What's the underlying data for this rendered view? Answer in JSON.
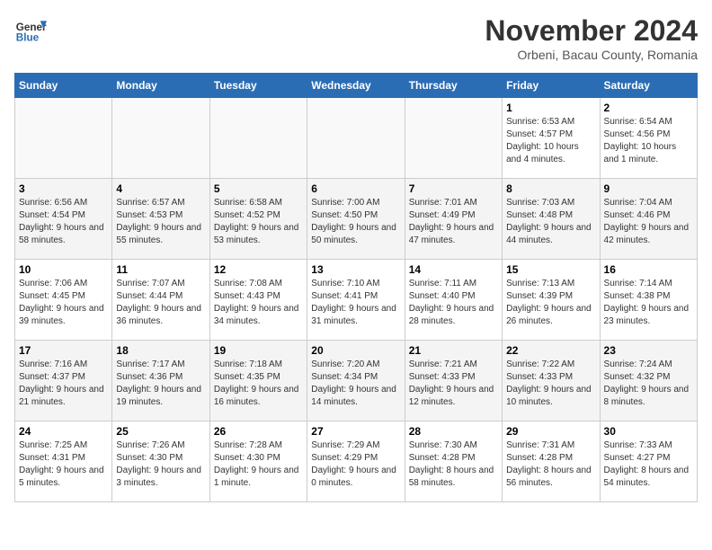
{
  "header": {
    "logo_line1": "General",
    "logo_line2": "Blue",
    "title": "November 2024",
    "subtitle": "Orbeni, Bacau County, Romania"
  },
  "weekdays": [
    "Sunday",
    "Monday",
    "Tuesday",
    "Wednesday",
    "Thursday",
    "Friday",
    "Saturday"
  ],
  "weeks": [
    [
      {
        "day": "",
        "info": ""
      },
      {
        "day": "",
        "info": ""
      },
      {
        "day": "",
        "info": ""
      },
      {
        "day": "",
        "info": ""
      },
      {
        "day": "",
        "info": ""
      },
      {
        "day": "1",
        "info": "Sunrise: 6:53 AM\nSunset: 4:57 PM\nDaylight: 10 hours and 4 minutes."
      },
      {
        "day": "2",
        "info": "Sunrise: 6:54 AM\nSunset: 4:56 PM\nDaylight: 10 hours and 1 minute."
      }
    ],
    [
      {
        "day": "3",
        "info": "Sunrise: 6:56 AM\nSunset: 4:54 PM\nDaylight: 9 hours and 58 minutes."
      },
      {
        "day": "4",
        "info": "Sunrise: 6:57 AM\nSunset: 4:53 PM\nDaylight: 9 hours and 55 minutes."
      },
      {
        "day": "5",
        "info": "Sunrise: 6:58 AM\nSunset: 4:52 PM\nDaylight: 9 hours and 53 minutes."
      },
      {
        "day": "6",
        "info": "Sunrise: 7:00 AM\nSunset: 4:50 PM\nDaylight: 9 hours and 50 minutes."
      },
      {
        "day": "7",
        "info": "Sunrise: 7:01 AM\nSunset: 4:49 PM\nDaylight: 9 hours and 47 minutes."
      },
      {
        "day": "8",
        "info": "Sunrise: 7:03 AM\nSunset: 4:48 PM\nDaylight: 9 hours and 44 minutes."
      },
      {
        "day": "9",
        "info": "Sunrise: 7:04 AM\nSunset: 4:46 PM\nDaylight: 9 hours and 42 minutes."
      }
    ],
    [
      {
        "day": "10",
        "info": "Sunrise: 7:06 AM\nSunset: 4:45 PM\nDaylight: 9 hours and 39 minutes."
      },
      {
        "day": "11",
        "info": "Sunrise: 7:07 AM\nSunset: 4:44 PM\nDaylight: 9 hours and 36 minutes."
      },
      {
        "day": "12",
        "info": "Sunrise: 7:08 AM\nSunset: 4:43 PM\nDaylight: 9 hours and 34 minutes."
      },
      {
        "day": "13",
        "info": "Sunrise: 7:10 AM\nSunset: 4:41 PM\nDaylight: 9 hours and 31 minutes."
      },
      {
        "day": "14",
        "info": "Sunrise: 7:11 AM\nSunset: 4:40 PM\nDaylight: 9 hours and 28 minutes."
      },
      {
        "day": "15",
        "info": "Sunrise: 7:13 AM\nSunset: 4:39 PM\nDaylight: 9 hours and 26 minutes."
      },
      {
        "day": "16",
        "info": "Sunrise: 7:14 AM\nSunset: 4:38 PM\nDaylight: 9 hours and 23 minutes."
      }
    ],
    [
      {
        "day": "17",
        "info": "Sunrise: 7:16 AM\nSunset: 4:37 PM\nDaylight: 9 hours and 21 minutes."
      },
      {
        "day": "18",
        "info": "Sunrise: 7:17 AM\nSunset: 4:36 PM\nDaylight: 9 hours and 19 minutes."
      },
      {
        "day": "19",
        "info": "Sunrise: 7:18 AM\nSunset: 4:35 PM\nDaylight: 9 hours and 16 minutes."
      },
      {
        "day": "20",
        "info": "Sunrise: 7:20 AM\nSunset: 4:34 PM\nDaylight: 9 hours and 14 minutes."
      },
      {
        "day": "21",
        "info": "Sunrise: 7:21 AM\nSunset: 4:33 PM\nDaylight: 9 hours and 12 minutes."
      },
      {
        "day": "22",
        "info": "Sunrise: 7:22 AM\nSunset: 4:33 PM\nDaylight: 9 hours and 10 minutes."
      },
      {
        "day": "23",
        "info": "Sunrise: 7:24 AM\nSunset: 4:32 PM\nDaylight: 9 hours and 8 minutes."
      }
    ],
    [
      {
        "day": "24",
        "info": "Sunrise: 7:25 AM\nSunset: 4:31 PM\nDaylight: 9 hours and 5 minutes."
      },
      {
        "day": "25",
        "info": "Sunrise: 7:26 AM\nSunset: 4:30 PM\nDaylight: 9 hours and 3 minutes."
      },
      {
        "day": "26",
        "info": "Sunrise: 7:28 AM\nSunset: 4:30 PM\nDaylight: 9 hours and 1 minute."
      },
      {
        "day": "27",
        "info": "Sunrise: 7:29 AM\nSunset: 4:29 PM\nDaylight: 9 hours and 0 minutes."
      },
      {
        "day": "28",
        "info": "Sunrise: 7:30 AM\nSunset: 4:28 PM\nDaylight: 8 hours and 58 minutes."
      },
      {
        "day": "29",
        "info": "Sunrise: 7:31 AM\nSunset: 4:28 PM\nDaylight: 8 hours and 56 minutes."
      },
      {
        "day": "30",
        "info": "Sunrise: 7:33 AM\nSunset: 4:27 PM\nDaylight: 8 hours and 54 minutes."
      }
    ]
  ]
}
